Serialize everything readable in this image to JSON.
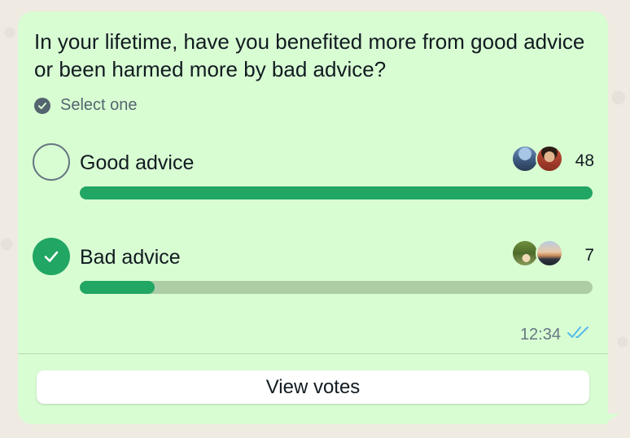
{
  "poll": {
    "question": "In your lifetime, have you benefited more from good advice or been harmed more by bad advice?",
    "instruction": "Select one",
    "options": [
      {
        "label": "Good advice",
        "votes": "48",
        "selected": false,
        "fill_fraction": 1.0,
        "avatars": [
          "avatar-landscape-icon",
          "avatar-person-icon"
        ]
      },
      {
        "label": "Bad advice",
        "votes": "7",
        "selected": true,
        "fill_fraction": 0.146,
        "avatars": [
          "avatar-outdoor-icon",
          "avatar-sunset-icon"
        ]
      }
    ]
  },
  "message": {
    "time": "12:34",
    "status_icon": "double-check-read-icon"
  },
  "actions": {
    "view_votes_label": "View votes"
  },
  "colors": {
    "bubble": "#d9fdd3",
    "accent": "#21a663",
    "track": "#adcda6",
    "read_ticks": "#53bdeb"
  }
}
